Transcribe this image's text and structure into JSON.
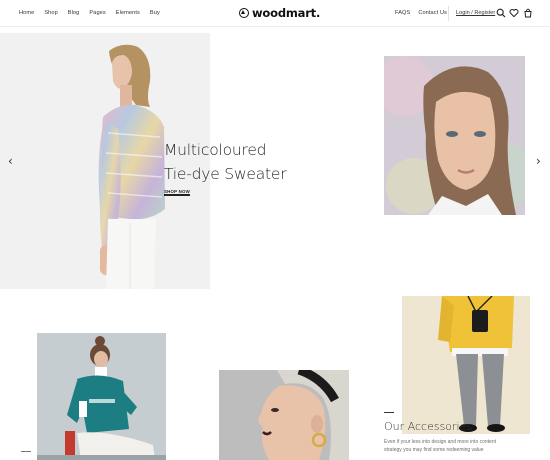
{
  "header": {
    "nav_left": [
      "Home",
      "Shop",
      "Blog",
      "Pages",
      "Elements",
      "Buy"
    ],
    "logo": "woodmart.",
    "nav_right": [
      "FAQS",
      "Contact Us"
    ],
    "login": "Login / Register",
    "icons": [
      "search-icon",
      "heart-icon",
      "cart-icon"
    ]
  },
  "hero": {
    "title_line1": "Multicoloured",
    "title_line2": "Tie-dye Sweater",
    "link": "SHOP NOW",
    "prev_arrow": "‹",
    "next_arrow": "›"
  },
  "accessories": {
    "title": "Our Accessories",
    "text": "Even if your less into design and more into content strategy you may find some redeeming value"
  },
  "colors": {
    "text": "#242424",
    "hero_bg": "#f1f1f2",
    "tile_teal": "#1e7f80",
    "tile_yellow": "#f0c436"
  }
}
